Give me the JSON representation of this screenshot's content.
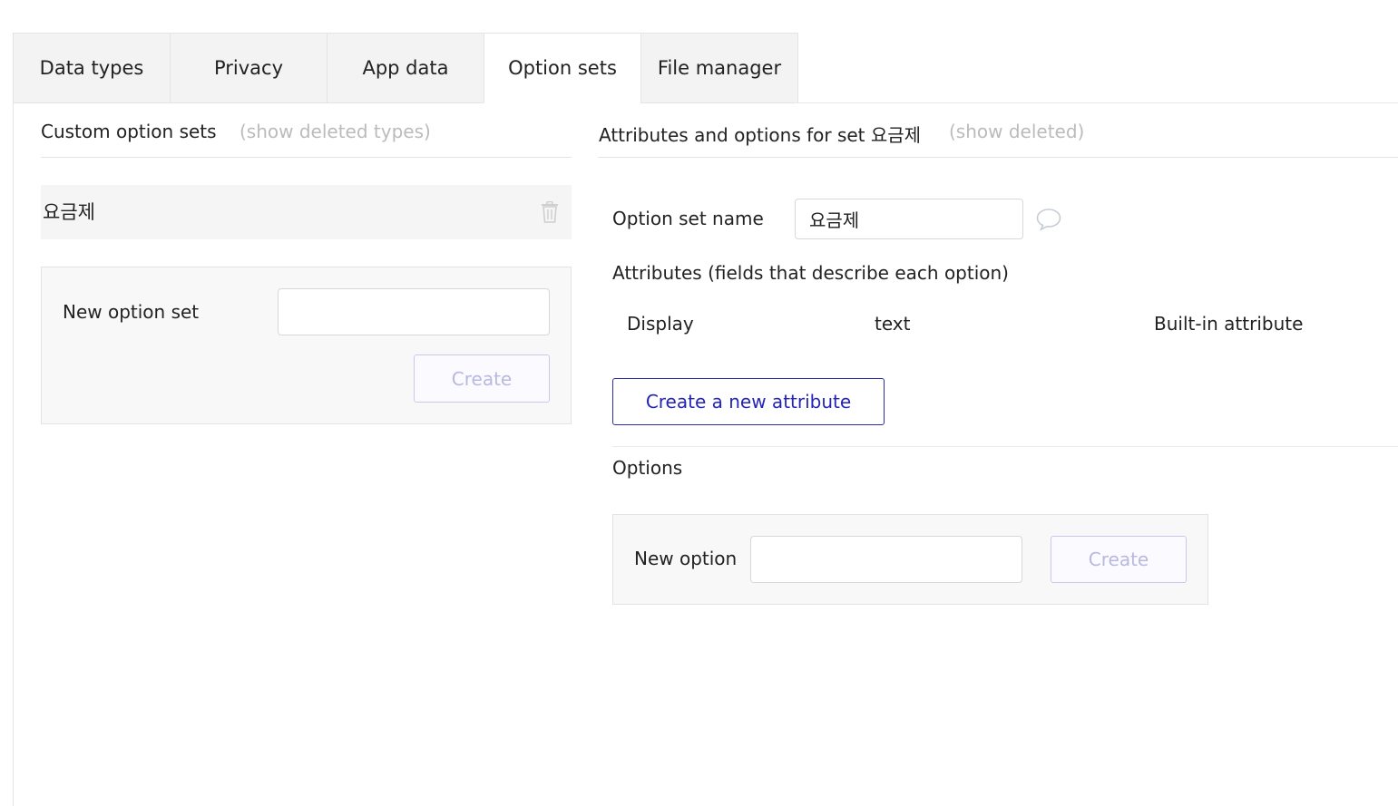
{
  "tabs": [
    {
      "label": "Data types"
    },
    {
      "label": "Privacy"
    },
    {
      "label": "App data"
    },
    {
      "label": "Option sets"
    },
    {
      "label": "File manager"
    }
  ],
  "active_tab": "Option sets",
  "left_panel": {
    "title": "Custom option sets",
    "show_deleted_link": "(show deleted types)",
    "option_sets": [
      {
        "name": "요금제"
      }
    ],
    "new_set_form": {
      "label": "New option set",
      "value": "",
      "create_label": "Create"
    }
  },
  "right_panel": {
    "title": "Attributes and options for set 요금제",
    "show_deleted_link": "(show deleted)",
    "set_name_label": "Option set name",
    "set_name_value": "요금제",
    "attributes_heading": "Attributes (fields that describe each option)",
    "attributes": [
      {
        "name": "Display",
        "type": "text",
        "note": "Built-in attribute"
      }
    ],
    "create_attribute_label": "Create a new attribute",
    "options_heading": "Options",
    "new_option_form": {
      "label": "New option",
      "value": "",
      "create_label": "Create"
    }
  },
  "icons": {
    "trash": "trash-icon",
    "comment": "speech-bubble-icon"
  },
  "colors": {
    "accent": "#2424b8",
    "muted": "#bbbbbb",
    "panel_bg": "#f8f8f8"
  }
}
